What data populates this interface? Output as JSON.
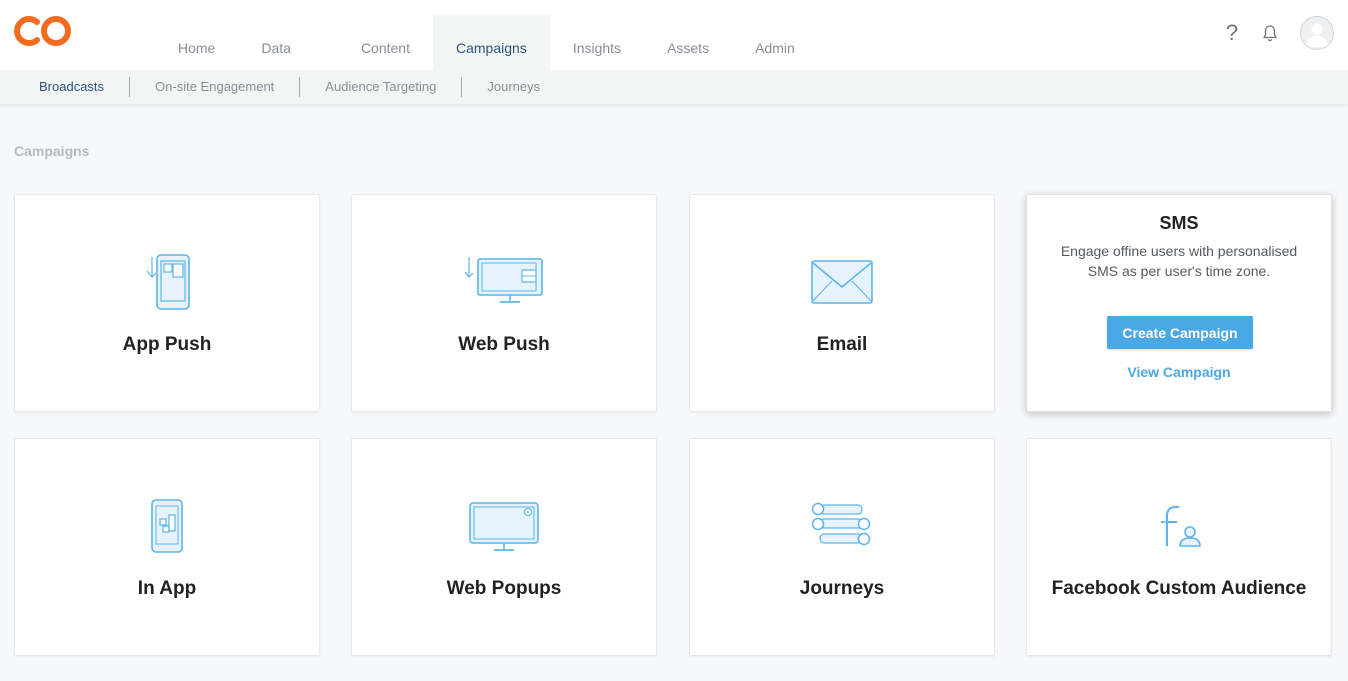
{
  "brand": {
    "logo": "circle-co-logo-icon",
    "color": "#f26b21"
  },
  "colors": {
    "accent": "#4aa8e3",
    "nav_active": "#2b5580",
    "icon_stroke": "#5cb4ea",
    "icon_fill": "#e6f3fc"
  },
  "main_nav": [
    {
      "label": "Home"
    },
    {
      "label": "Data"
    },
    {
      "label": "Content"
    },
    {
      "label": "Campaigns",
      "active": true
    },
    {
      "label": "Insights"
    },
    {
      "label": "Assets"
    },
    {
      "label": "Admin"
    }
  ],
  "top_icons": {
    "help": "?",
    "notifications": "bell-icon",
    "profile": "avatar-icon"
  },
  "sub_nav": [
    {
      "label": "Broadcasts",
      "active": true
    },
    {
      "label": "On-site Engagement"
    },
    {
      "label": "Audience Targeting"
    },
    {
      "label": "Journeys"
    }
  ],
  "section_title": "Campaigns",
  "cards": [
    {
      "label": "App Push",
      "icon": "app-push-icon"
    },
    {
      "label": "Web Push",
      "icon": "web-push-icon"
    },
    {
      "label": "Email",
      "icon": "email-icon"
    },
    {
      "label": "SMS",
      "description": "Engage offine users with personalised SMS as per user's time zone.",
      "primary_action": "Create Campaign",
      "secondary_action": "View Campaign",
      "hovered": true
    },
    {
      "label": "In App",
      "icon": "in-app-icon"
    },
    {
      "label": "Web Popups",
      "icon": "web-popups-icon"
    },
    {
      "label": "Journeys",
      "icon": "journeys-icon"
    },
    {
      "label": "Facebook Custom Audience",
      "icon": "facebook-audience-icon"
    }
  ]
}
